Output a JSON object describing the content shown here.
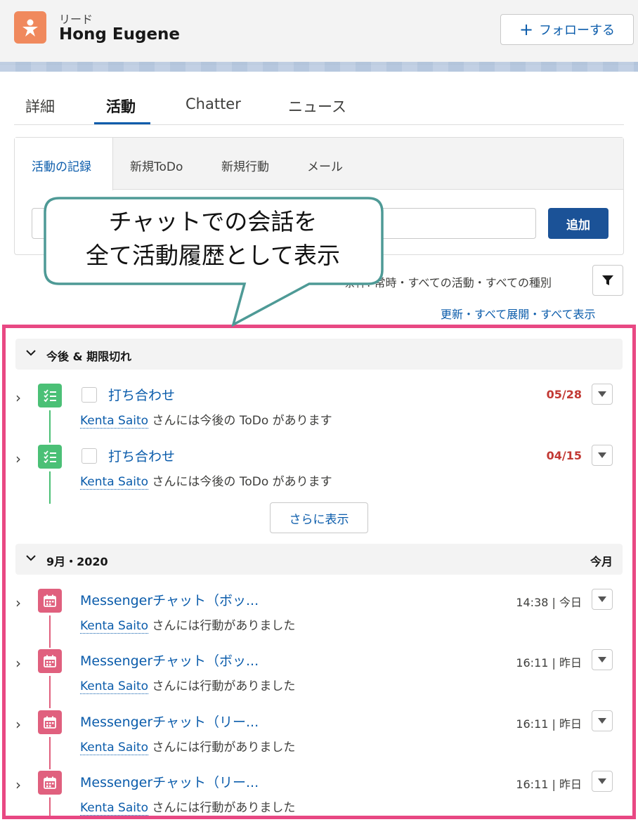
{
  "header": {
    "record_type": "リード",
    "record_name": "Hong Eugene",
    "follow_label": "フォローする"
  },
  "tabs": [
    {
      "label": "詳細"
    },
    {
      "label": "活動"
    },
    {
      "label": "Chatter"
    },
    {
      "label": "ニュース"
    }
  ],
  "composer": {
    "tabs": [
      {
        "label": "活動の記録"
      },
      {
        "label": "新規ToDo"
      },
      {
        "label": "新規行動"
      },
      {
        "label": "メール"
      }
    ],
    "add_label": "追加"
  },
  "filters": {
    "text": "条件: 常時・すべての活動・すべての種別",
    "links": "更新・すべて展開・すべて表示"
  },
  "callout": {
    "line1": "チャットでの会話を",
    "line2": "全て活動履歴として表示"
  },
  "upcoming": {
    "title": "今後 & 期限切れ",
    "items": [
      {
        "subject": "打ち合わせ",
        "who": "Kenta Saito",
        "rest": " さんには今後の ToDo があります",
        "date": "05/28"
      },
      {
        "subject": "打ち合わせ",
        "who": "Kenta Saito",
        "rest": " さんには今後の ToDo があります",
        "date": "04/15"
      }
    ],
    "more_label": "さらに表示"
  },
  "month": {
    "title": "9月・2020",
    "right": "今月",
    "items": [
      {
        "subject": "Messengerチャット（ボッ...",
        "who": "Kenta Saito",
        "rest": " さんには行動がありました",
        "date": "14:38 | 今日"
      },
      {
        "subject": "Messengerチャット（ボッ...",
        "who": "Kenta Saito",
        "rest": " さんには行動がありました",
        "date": "16:11 | 昨日"
      },
      {
        "subject": "Messengerチャット（リー...",
        "who": "Kenta Saito",
        "rest": " さんには行動がありました",
        "date": "16:11 | 昨日"
      },
      {
        "subject": "Messengerチャット（リー...",
        "who": "Kenta Saito",
        "rest": " さんには行動がありました",
        "date": "16:11 | 昨日"
      }
    ]
  },
  "colors": {
    "brand_blue": "#0b5cab",
    "lead_icon": "#f0895d",
    "task_green": "#4bc076",
    "event_pink": "#e0607e",
    "highlight": "#e84883",
    "overdue_red": "#c23934"
  },
  "icons": {
    "lead": "lead-icon",
    "task": "task-list-icon",
    "event": "calendar-icon",
    "filter": "filter-icon"
  }
}
